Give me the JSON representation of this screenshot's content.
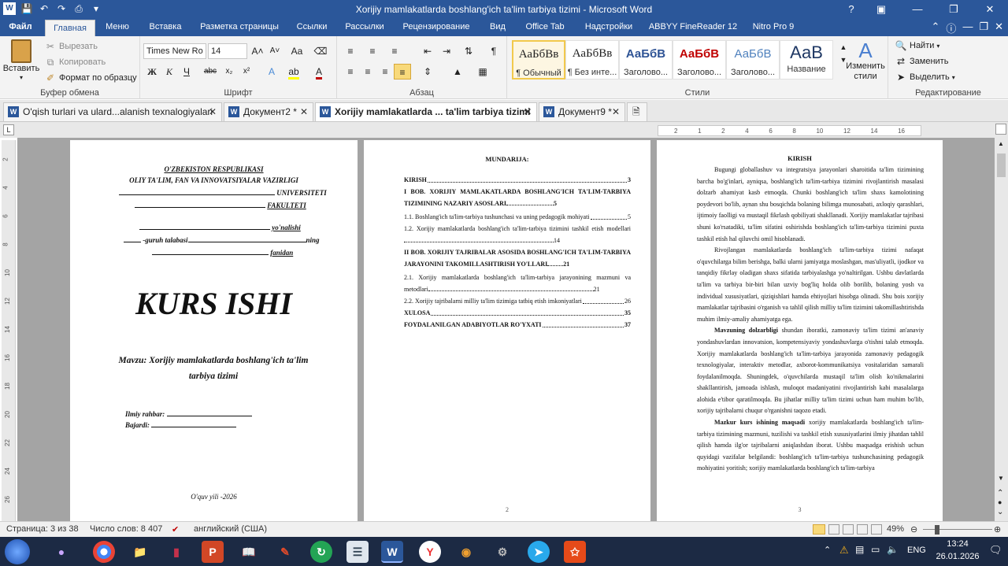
{
  "window": {
    "title": "Xorijiy mamlakatlarda boshlang'ich ta'lim tarbiya tizimi  -  Microsoft Word"
  },
  "ribbon_tabs": [
    "Файл",
    "Главная",
    "Меню",
    "Вставка",
    "Разметка страницы",
    "Ссылки",
    "Рассылки",
    "Рецензирование",
    "Вид",
    "Office Tab",
    "Надстройки",
    "ABBYY FineReader 12",
    "Nitro Pro 9"
  ],
  "clipboard": {
    "paste": "Вставить",
    "cut": "Вырезать",
    "copy": "Копировать",
    "format_painter": "Формат по образцу",
    "label": "Буфер обмена"
  },
  "font": {
    "name": "Times New Ro",
    "size": "14",
    "label": "Шрифт"
  },
  "paragraph": {
    "label": "Абзац"
  },
  "styles": {
    "items": [
      {
        "preview": "АаБбВв",
        "name": "¶ Обычный"
      },
      {
        "preview": "АаБбВв",
        "name": "¶ Без инте..."
      },
      {
        "preview": "АаБбВ",
        "name": "Заголово..."
      },
      {
        "preview": "АаБбВ",
        "name": "Заголово..."
      },
      {
        "preview": "АаБбВ",
        "name": "Заголово..."
      },
      {
        "preview": "АаВ",
        "name": "Название"
      }
    ],
    "change": "Изменить стили",
    "label": "Стили"
  },
  "editing": {
    "find": "Найти",
    "replace": "Заменить",
    "select": "Выделить",
    "label": "Редактирование"
  },
  "doc_tabs": [
    {
      "label": "O'qish turlari va ulard...alanish texnalogiyalari"
    },
    {
      "label": "Документ2 *"
    },
    {
      "label": "Xorijiy mamlakatlarda ... ta'lim tarbiya tizimi"
    },
    {
      "label": "Документ9 *"
    }
  ],
  "ruler_numbers": [
    "2",
    "1",
    "2",
    "4",
    "6",
    "8",
    "10",
    "12",
    "14",
    "16"
  ],
  "vruler_numbers": [
    "2",
    "4",
    "6",
    "8",
    "10",
    "12",
    "14",
    "16",
    "18",
    "20",
    "22",
    "24",
    "26"
  ],
  "page1": {
    "republic": "O'ZBEKISTON  RESPUBLIKASI",
    "ministry": "OLIY TA'LIM, FAN VA INNOVATSIYALAR VAZIRLIGI",
    "university": "UNIVERSITETI",
    "faculty": "FAKULTETI",
    "direction": "yo'nalishi",
    "group_prefix": "-guruh talabasi",
    "group_suffix": "ning",
    "subject": "fanidan",
    "heading": "KURS ISHI",
    "topic": "Mavzu: Xorijiy mamlakatlarda boshlang'ich ta'lim tarbiya tizimi",
    "supervisor": "Ilmiy rahbar:",
    "performer": "Bajardi:",
    "year": "O'quv yili -2026"
  },
  "page2": {
    "title": "MUNDARIJA:",
    "entries": [
      {
        "text": "KIRISH",
        "page": "3",
        "bold": true
      },
      {
        "text": "I BOB. XORIJIY MAMLAKATLARDA BOSHLANG'ICH TA'LIM-TARBIYA TIZIMINING NAZARIY ASOSLARI",
        "page": "5",
        "bold": true
      },
      {
        "text": "1.1. Boshlang'ich ta'lim-tarbiya tushunchasi va uning pedagogik mohiyati",
        "page": "5",
        "bold": false
      },
      {
        "text": "1.2. Xorijiy mamlakatlarda boshlang'ich ta'lim-tarbiya tizimini tashkil etish modellari",
        "page": "14",
        "bold": false
      },
      {
        "text": "II BOB. XORIJIY TAJRIBALAR ASOSIDA BOSHLANG'ICH TA'LIM-TARBIYA JARAYONINI TAKOMILLASHTIRISH YO'LLARI",
        "page": "21",
        "bold": true
      },
      {
        "text": "2.1. Xorijiy mamlakatlarda boshlang'ich ta'lim-tarbiya jarayonining mazmuni va metodlari",
        "page": "21",
        "bold": false
      },
      {
        "text": "2.2. Xorijiy tajribalarni milliy ta'lim tizimiga tatbiq etish imkoniyatlari",
        "page": "26",
        "bold": false
      },
      {
        "text": "XULOSA",
        "page": "35",
        "bold": true
      },
      {
        "text": "FOYDALANILGAN ADABIYOTLAR RO'YXATI",
        "page": "37",
        "bold": true
      }
    ],
    "page_number": "2"
  },
  "page3": {
    "title": "KIRISH",
    "para1": "Bugungi globallashuv va integratsiya jarayonlari sharoitida ta'lim tizimining barcha bo'g'inlari, ayniqsa, boshlang'ich ta'lim-tarbiya tizimini rivojlantirish masalasi dolzarb ahamiyat kasb etmoqda. Chunki boshlang'ich ta'lim shaxs kamolotining poydevori bo'lib, aynan shu bosqichda bolaning bilimga munosabati, axloqiy qarashlari, ijtimoiy faolligi va mustaqil fikrlash qobiliyati shakllanadi. Xorijiy mamlakatlar tajribasi shuni ko'rsatadiki, ta'lim sifatini oshirishda boshlang'ich ta'lim-tarbiya tizimini puxta tashkil etish hal qiluvchi omil hisoblanadi.",
    "para2": "Rivojlangan mamlakatlarda boshlang'ich ta'lim-tarbiya tizimi nafaqat o'quvchilarga bilim berishga, balki ularni jamiyatga moslashgan, mas'uliyatli, ijodkor va tanqidiy fikrlay oladigan shaxs sifatida tarbiyalashga yo'naltirilgan. Ushbu davlatlarda ta'lim va tarbiya bir-biri bilan uzviy bog'liq holda olib borilib, bolaning yosh va individual xususiyatlari, qiziqishlari hamda ehtiyojlari hisobga olinadi. Shu bois xorijiy mamlakatlar tajribasini o'rganish va tahlil qilish milliy ta'lim tizimini takomillashtirishda muhim ilmiy-amaliy ahamiyatga ega.",
    "para3_lead": "Mavzuning dolzarbligi",
    "para3": " shundan iboratki, zamonaviy ta'lim tizimi an'anaviy yondashuvlardan innovatsion, kompetensiyaviy yondashuvlarga o'tishni talab etmoqda. Xorijiy mamlakatlarda boshlang'ich ta'lim-tarbiya jarayonida zamonaviy pedagogik texnologiyalar, interaktiv metodlar, axborot-kommunikatsiya vositalaridan samarali foydalanilmoqda. Shuningdek, o'quvchilarda mustaqil ta'lim olish ko'nikmalarini shakllantirish, jamoada ishlash, muloqot madaniyatini rivojlantirish kabi masalalarga alohida e'tibor qaratilmoqda. Bu jihatlar milliy ta'lim tizimi uchun ham muhim bo'lib, xorijiy tajribalarni chuqur o'rganishni taqozo etadi.",
    "para4_lead": "Mazkur kurs ishining maqsadi",
    "para4": " xorijiy mamlakatlarda boshlang'ich ta'lim-tarbiya tizimining mazmuni, tuzilishi va tashkil etish xususiyatlarini ilmiy jihatdan tahlil qilish hamda ilg'or tajribalarni aniqlashdan iborat. Ushbu maqsadga erishish uchun quyidagi vazifalar belgilandi: boshlang'ich ta'lim-tarbiya tushunchasining pedagogik mohiyatini yoritish; xorijiy mamlakatlarda boshlang'ich ta'lim-tarbiya",
    "page_number": "3"
  },
  "statusbar": {
    "page": "Страница: 3 из 38",
    "words": "Число слов: 8 407",
    "language": "английский (США)",
    "zoom": "49%"
  },
  "tray": {
    "lang": "ENG",
    "time": "13:24",
    "date": "26.01.2026"
  }
}
